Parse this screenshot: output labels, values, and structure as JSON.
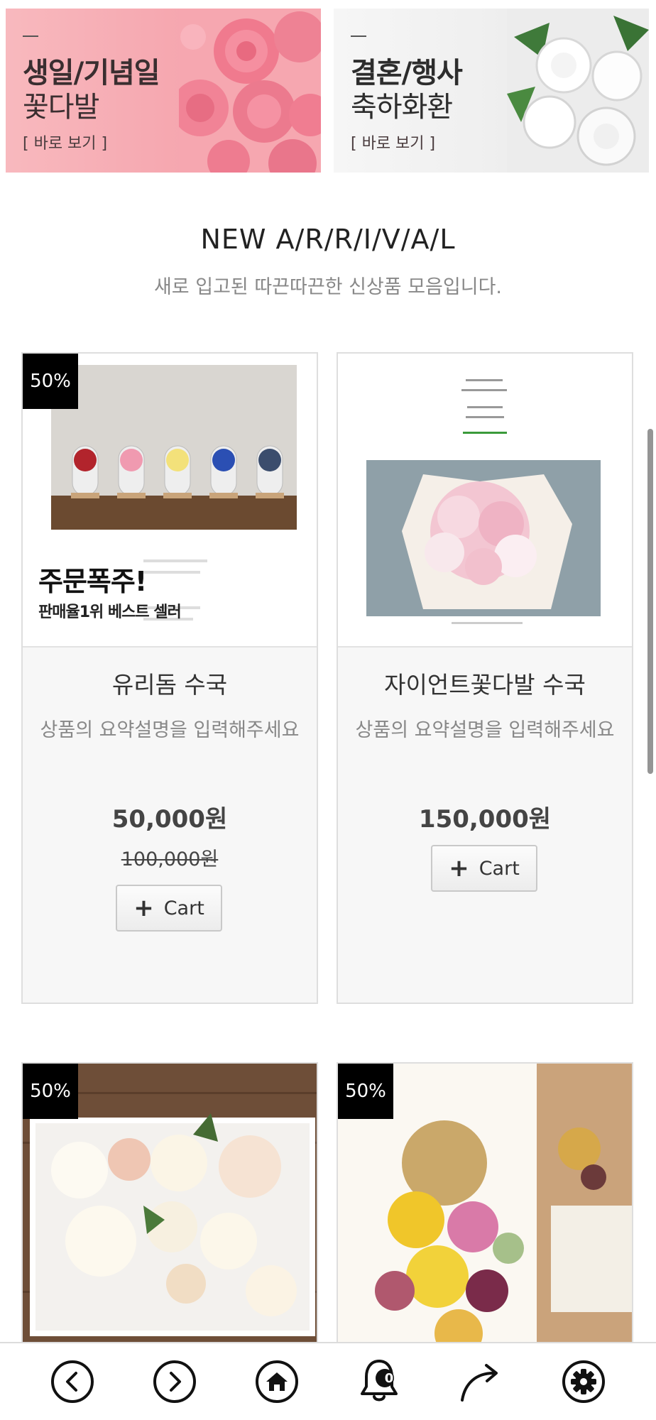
{
  "banners": [
    {
      "title_line1": "생일/기념일",
      "title_line2": "꽃다발",
      "link": "[ 바로 보기 ]"
    },
    {
      "title_line1": "결혼/행사",
      "title_line2": "축하화환",
      "link": "[ 바로 보기 ]"
    }
  ],
  "section": {
    "title": "NEW A/R/R/I/V/A/L",
    "subtitle": "새로 입고된 따끈따끈한 신상품 모음입니다."
  },
  "products": [
    {
      "badge": "50%",
      "thumb_headline": "주문폭주!",
      "thumb_subline": "판매율1위 베스트 셀러",
      "name": "유리돔 수국",
      "desc": "상품의 요약설명을 입력해주세요",
      "price": "50,000원",
      "old_price": "100,000원",
      "cart_label": "Cart"
    },
    {
      "badge": "",
      "name": "자이언트꽃다발 수국",
      "desc": "상품의 요약설명을 입력해주세요",
      "price": "150,000원",
      "cart_label": "Cart"
    },
    {
      "badge": "50%"
    },
    {
      "badge": "50%"
    }
  ],
  "nav": {
    "notification_count": "0",
    "icons": [
      "back-icon",
      "forward-icon",
      "home-icon",
      "bell-icon",
      "share-icon",
      "settings-icon"
    ]
  },
  "colors": {
    "badge_bg": "#000000",
    "banner1_bg": "#f6aab2",
    "banner2_bg": "#efefef"
  }
}
